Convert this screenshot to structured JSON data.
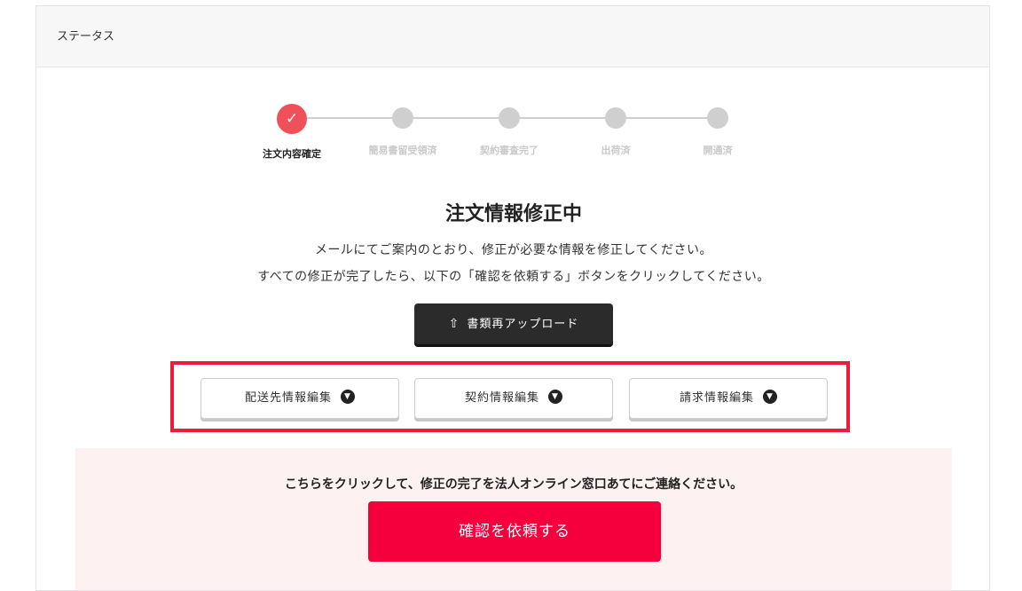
{
  "header": {
    "title": "ステータス"
  },
  "stepper": {
    "steps": [
      {
        "label": "注文内容確定",
        "state": "done"
      },
      {
        "label": "簡易書留受領済",
        "state": "pending"
      },
      {
        "label": "契約審査完了",
        "state": "pending"
      },
      {
        "label": "出荷済",
        "state": "pending"
      },
      {
        "label": "開通済",
        "state": "pending"
      }
    ],
    "done_icon": "check-icon"
  },
  "status": {
    "title": "注文情報修正中",
    "description_line1": "メールにてご案内のとおり、修正が必要な情報を修正してください。",
    "description_line2": "すべての修正が完了したら、以下の「確認を依頼する」ボタンをクリックしてください。"
  },
  "upload": {
    "label": "書類再アップロード",
    "icon": "upload-icon"
  },
  "edit_buttons": [
    {
      "label": "配送先情報編集",
      "icon": "chevron-down-circle-icon"
    },
    {
      "label": "契約情報編集",
      "icon": "chevron-down-circle-icon"
    },
    {
      "label": "請求情報編集",
      "icon": "chevron-down-circle-icon"
    }
  ],
  "notice": {
    "text": "こちらをクリックして、修正の完了を法人オンライン窓口あてにご連絡ください。",
    "confirm_label": "確認を依頼する"
  },
  "colors": {
    "accent": "#f5003d",
    "step_done": "#f0505a",
    "highlight_border": "#ee1b3b",
    "notice_bg": "#fdf1f1",
    "dark_button": "#2b2b2b"
  }
}
